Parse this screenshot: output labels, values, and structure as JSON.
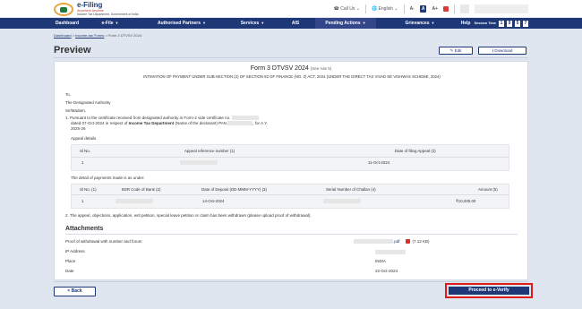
{
  "header": {
    "logo_title": "e-Filing",
    "logo_tagline": "Anywhere Anytime",
    "logo_dept": "Income Tax Department, Government of India",
    "call_us": "Call Us",
    "language": "English",
    "font_small": "A-",
    "font_normal": "A",
    "font_large": "A+"
  },
  "nav": {
    "items": [
      {
        "label": "Dashboard"
      },
      {
        "label": "e-File"
      },
      {
        "label": "Authorised Partners"
      },
      {
        "label": "Services"
      },
      {
        "label": "AIS"
      },
      {
        "label": "Pending Actions"
      },
      {
        "label": "Grievances"
      },
      {
        "label": "Help"
      }
    ],
    "session_label": "Session Time",
    "session_digits": [
      "1",
      "9",
      "5",
      "7"
    ]
  },
  "breadcrumb": {
    "home": "Dashboard",
    "section": "Income-tax Forms",
    "current": "Form 3 DTVSV 2024"
  },
  "page": {
    "title": "Preview",
    "edit_label": "Edit",
    "download_label": "Download"
  },
  "form": {
    "title": "Form 3 DTVSV 2024",
    "rule": "(See rule 5)",
    "subtitle": "INTIMATION OF PAYMENT UNDER SUB-SECTION (2) OF SECTION 92 OF FINANCE (NO. 2) ACT, 2024 (UNDER THE DIRECT TAX VIVAD SE VISHWAS SCHEME, 2024)",
    "to": "To,",
    "authority": "The Designated Authority",
    "salutation": "Sir/Madam,",
    "point1_a": "1. Pursuant to the certificate received from designated authority in Form-2 vide certificate no.",
    "point1_b": "dated",
    "point1_date": "07-Oct-2024",
    "point1_c": "in respect of",
    "point1_dept": "Income Tax Department",
    "point1_d": "(Name of the declarant) PAN",
    "point1_e": ", for A.Y.",
    "point1_ay": "2025-26",
    "appeal_details_label": "Appeal details",
    "appeal_table": {
      "headers": [
        "Sl No.",
        "Appeal reference number (1)",
        "Date of filing Appeal (2)"
      ],
      "row": {
        "sl": "1",
        "date": "11-Oct-2024"
      }
    },
    "payment_intro": "The detail of payments made is as under:",
    "payment_table": {
      "headers": [
        "Sl No. (1)",
        "BSR Code of Bank (2)",
        "Date of Deposit (DD-MMM-YYYY) (3)",
        "Serial Number of Challan (4)",
        "Amount (5)"
      ],
      "row": {
        "sl": "1",
        "date": "14-Oct-2024",
        "amount": "₹10,000.00"
      }
    },
    "point2": "2. The appeal, objections, application, writ petition, special leave petition or claim has been withdrawn (please upload proof of withdrawal)."
  },
  "attachments": {
    "title": "Attachments",
    "proof_label": "Proof of withdrawal with number and forum",
    "file_ext": ".pdf",
    "file_size": "(7.12 KB)",
    "ip_label": "IP Address",
    "place_label": "Place",
    "place_value": "INDIA",
    "date_label": "Date",
    "date_value": "22-Oct-2024"
  },
  "footer": {
    "back_label": "< Back",
    "proceed_label": "Proceed to e-Verify"
  },
  "colors": {
    "primary": "#1d3777",
    "highlight": "#e11a1a",
    "background": "#dfe6f0"
  }
}
